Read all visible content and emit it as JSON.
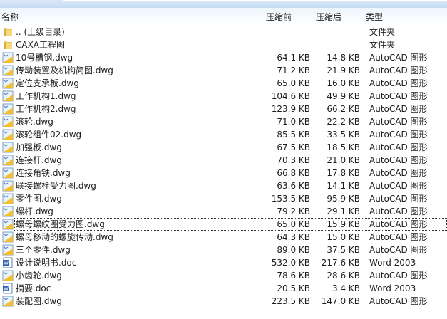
{
  "columns": {
    "name": "名称",
    "before": "压缩前",
    "after": "压缩后",
    "type": "类型"
  },
  "rows": [
    {
      "name": ".. (上级目录)",
      "before": "",
      "after": "",
      "type": "文件夹",
      "icon": "folder"
    },
    {
      "name": "CAXA工程图",
      "before": "",
      "after": "",
      "type": "文件夹",
      "icon": "folder"
    },
    {
      "name": "10号槽钢.dwg",
      "before": "64.1 KB",
      "after": "14.8 KB",
      "type": "AutoCAD 图形",
      "icon": "dwg"
    },
    {
      "name": "传动装置及机构简图.dwg",
      "before": "71.2 KB",
      "after": "21.9 KB",
      "type": "AutoCAD 图形",
      "icon": "dwg"
    },
    {
      "name": "定位支承板.dwg",
      "before": "65.0 KB",
      "after": "16.0 KB",
      "type": "AutoCAD 图形",
      "icon": "dwg"
    },
    {
      "name": "工作机构1.dwg",
      "before": "104.6 KB",
      "after": "49.9 KB",
      "type": "AutoCAD 图形",
      "icon": "dwg"
    },
    {
      "name": "工作机构2.dwg",
      "before": "123.9 KB",
      "after": "66.2 KB",
      "type": "AutoCAD 图形",
      "icon": "dwg"
    },
    {
      "name": "滚轮.dwg",
      "before": "71.0 KB",
      "after": "22.2 KB",
      "type": "AutoCAD 图形",
      "icon": "dwg"
    },
    {
      "name": "滚轮组件02.dwg",
      "before": "85.5 KB",
      "after": "33.5 KB",
      "type": "AutoCAD 图形",
      "icon": "dwg"
    },
    {
      "name": "加强板.dwg",
      "before": "67.5 KB",
      "after": "18.5 KB",
      "type": "AutoCAD 图形",
      "icon": "dwg"
    },
    {
      "name": "连接杆.dwg",
      "before": "70.3 KB",
      "after": "21.0 KB",
      "type": "AutoCAD 图形",
      "icon": "dwg"
    },
    {
      "name": "连接角铁.dwg",
      "before": "66.8 KB",
      "after": "17.8 KB",
      "type": "AutoCAD 图形",
      "icon": "dwg"
    },
    {
      "name": "联接螺栓受力图.dwg",
      "before": "63.6 KB",
      "after": "14.1 KB",
      "type": "AutoCAD 图形",
      "icon": "dwg"
    },
    {
      "name": "零件图.dwg",
      "before": "153.5 KB",
      "after": "95.9 KB",
      "type": "AutoCAD 图形",
      "icon": "dwg"
    },
    {
      "name": "螺杆.dwg",
      "before": "79.2 KB",
      "after": "29.1 KB",
      "type": "AutoCAD 图形",
      "icon": "dwg"
    },
    {
      "name": "螺母螺纹圈受力图.dwg",
      "before": "65.0 KB",
      "after": "15.9 KB",
      "type": "AutoCAD 图形",
      "icon": "dwg",
      "focus": true
    },
    {
      "name": "螺母移动的螺旋传动.dwg",
      "before": "64.3 KB",
      "after": "15.0 KB",
      "type": "AutoCAD 图形",
      "icon": "dwg"
    },
    {
      "name": "三个零件.dwg",
      "before": "89.0 KB",
      "after": "37.5 KB",
      "type": "AutoCAD 图形",
      "icon": "dwg"
    },
    {
      "name": "设计说明书.doc",
      "before": "532.0 KB",
      "after": "217.6 KB",
      "type": "Word 2003",
      "icon": "doc"
    },
    {
      "name": "小齿轮.dwg",
      "before": "78.6 KB",
      "after": "28.6 KB",
      "type": "AutoCAD 图形",
      "icon": "dwg"
    },
    {
      "name": "摘要.doc",
      "before": "20.5 KB",
      "after": "3.4 KB",
      "type": "Word 2003",
      "icon": "doc"
    },
    {
      "name": "装配图.dwg",
      "before": "223.5 KB",
      "after": "147.0 KB",
      "type": "AutoCAD 图形",
      "icon": "dwg"
    }
  ]
}
